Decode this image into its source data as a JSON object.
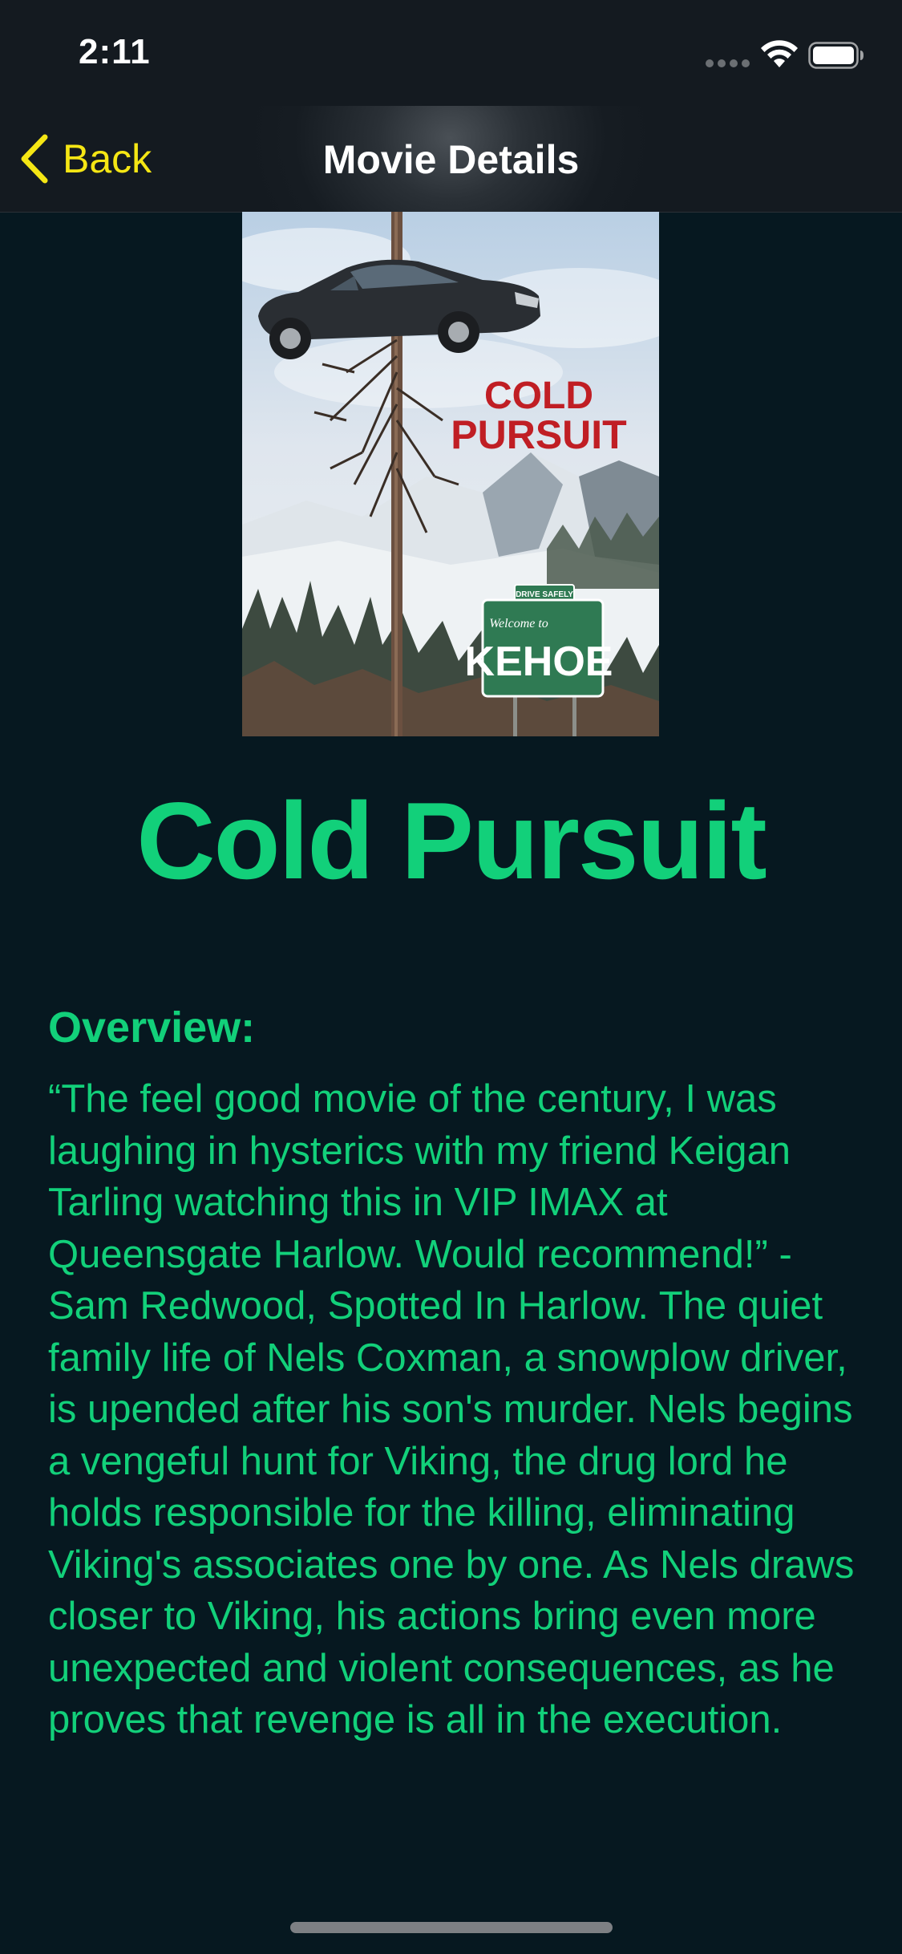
{
  "status_bar": {
    "time": "2:11"
  },
  "nav": {
    "back_label": "Back",
    "title": "Movie Details"
  },
  "poster": {
    "title_line1": "COLD",
    "title_line2": "PURSUIT",
    "sign_top": "DRIVE SAFELY",
    "sign_welcome": "Welcome to",
    "sign_town": "KEHOE"
  },
  "movie": {
    "title": "Cold Pursuit",
    "overview_heading": "Overview:",
    "overview_text": "“The feel good movie of the century, I was laughing in hysterics with my friend Keigan Tarling watching this in VIP IMAX at Queensgate Harlow. Would recommend!” - Sam Redwood, Spotted In Harlow. The quiet family life of Nels Coxman, a snowplow driver, is upended after his son's murder. Nels begins a vengeful hunt for Viking, the drug lord he holds responsible for the killing, eliminating Viking's associates one by one. As Nels draws closer to Viking, his actions bring even more unexpected and violent consequences, as he proves that revenge is all in the execution."
  },
  "colors": {
    "background": "#061820",
    "accent_green": "#12d07a",
    "nav_tint": "#f5e614",
    "bar_background": "#141a20"
  },
  "icons": {
    "back": "chevron-left-icon",
    "wifi": "wifi-icon",
    "battery": "battery-icon",
    "signal": "cellular-signal-icon"
  }
}
